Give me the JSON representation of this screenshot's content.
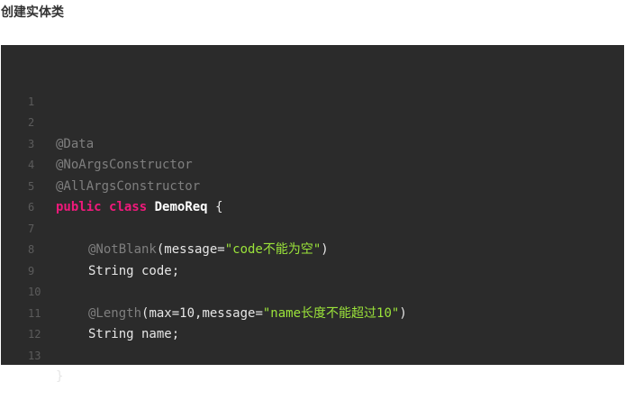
{
  "heading": "创建实体类",
  "code": {
    "line_numbers": [
      "1",
      "2",
      "3",
      "4",
      "5",
      "6",
      "7",
      "8",
      "9",
      "10",
      "11",
      "12",
      "13"
    ],
    "l2": "@Data",
    "l3": "@NoArgsConstructor",
    "l4": "@AllArgsConstructor",
    "l5": {
      "kw1": "public",
      "kw2": "class",
      "name": "DemoReq",
      "brace": "{"
    },
    "l7": {
      "anno": "@NotBlank",
      "open": "(message=",
      "str": "\"code不能为空\"",
      "close": ")"
    },
    "l8": "String code;",
    "l10": {
      "anno": "@Length",
      "open": "(max=10,message=",
      "str": "\"name长度不能超过10\"",
      "close": ")"
    },
    "l11": "String name;",
    "l13": "}"
  },
  "colors": {
    "background": "#2b2b2b",
    "annotation": "#7f7f7f",
    "keyword": "#f0197b",
    "string": "#9be33a",
    "text": "#e6e6e6"
  }
}
